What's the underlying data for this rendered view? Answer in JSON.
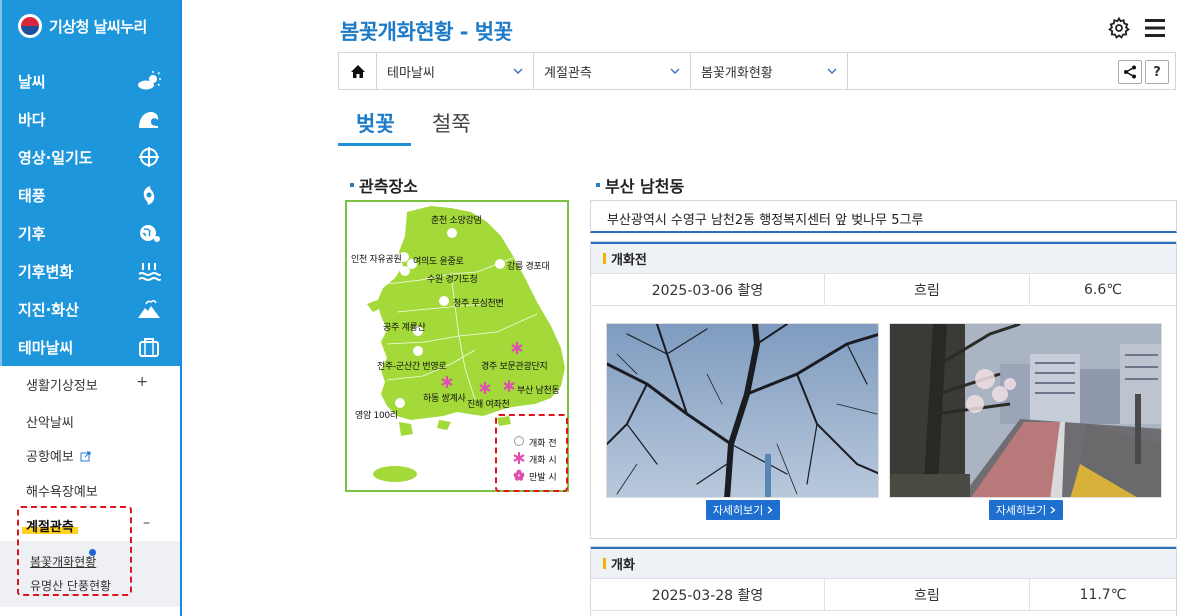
{
  "app": {
    "logo_text": "기상청 날씨누리",
    "colors": {
      "brand_blue": "#1e96dc",
      "title_blue": "#1d7bc8",
      "accent_yellow": "#ffd21e",
      "annotation_red": "#e0141e",
      "map_green": "#a4d93a"
    }
  },
  "sidebar": {
    "menu": [
      {
        "label": "날씨",
        "icon": "sun-cloud-icon"
      },
      {
        "label": "바다",
        "icon": "wave-icon"
      },
      {
        "label": "영상·일기도",
        "icon": "satellite-icon"
      },
      {
        "label": "태풍",
        "icon": "typhoon-icon"
      },
      {
        "label": "기후",
        "icon": "globe-icon"
      },
      {
        "label": "기후변화",
        "icon": "heat-wave-icon"
      },
      {
        "label": "지진·화산",
        "icon": "volcano-icon"
      },
      {
        "label": "테마날씨",
        "icon": "briefcase-icon"
      }
    ],
    "sub": {
      "life": "생활기상정보",
      "life_toggle": "+",
      "mountain": "산악날씨",
      "airport": "공항예보",
      "beach": "해수욕장예보",
      "season": "계절관측",
      "season_toggle": "–",
      "blossom": "봄꽃개화현황",
      "foliage": "유명산 단풍현황"
    }
  },
  "header": {
    "title": "봄꽃개화현황 - 벚꽃",
    "settings_icon": "gear-icon",
    "menu_icon": "hamburger-icon"
  },
  "breadcrumb": {
    "items": [
      "테마날씨",
      "계절관측",
      "봄꽃개화현황"
    ],
    "help_label": "?"
  },
  "tabs": [
    {
      "label": "벚꽃",
      "active": true
    },
    {
      "label": "철쭉",
      "active": false
    }
  ],
  "map": {
    "section_title": "관측장소",
    "locations": {
      "chuncheon": "춘천 소양강댐",
      "incheon": "인천 자유공원",
      "yeouido": "여의도 윤중로",
      "suwon": "수원 경기도청",
      "gangneung": "강릉 경포대",
      "cheongju": "청주 무심천변",
      "gongju": "공주 계룡산",
      "jeonju": "전주-군산간 번영로",
      "gyeongju": "경주 보문관광단지",
      "hadong": "하동 쌍계사",
      "busan": "부산 남천동",
      "jinhae": "진해 여좌천",
      "yeongam": "영암 100리"
    },
    "legend": {
      "before": "개화 전",
      "bloom": "개화 시",
      "full": "만발 시"
    }
  },
  "station": {
    "title": "부산 남천동",
    "address": "부산광역시 수영구 남천2동 행정복지센터 앞 벚나무 5그루",
    "cards": [
      {
        "heading": "개화전",
        "date": "2025-03-06 촬영",
        "weather": "흐림",
        "temp": "6.6℃",
        "detail_label": "자세히보기"
      },
      {
        "heading": "개화",
        "date": "2025-03-28 촬영",
        "weather": "흐림",
        "temp": "11.7℃"
      }
    ]
  }
}
